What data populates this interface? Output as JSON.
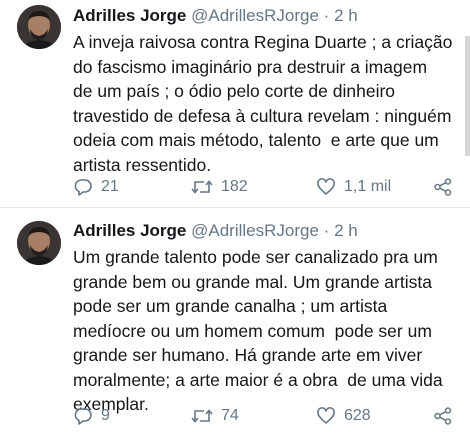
{
  "tweets": [
    {
      "author": "Adrilles Jorge",
      "handle": "@AdrillesRJorge",
      "separator": "·",
      "time": "2 h",
      "text": "A inveja raivosa contra Regina Duarte ; a criação\ndo fascismo imaginário pra destruir a imagem\nde um país ; o ódio pelo corte de dinheiro\ntravestido de defesa à cultura revelam : ninguém\nodeia com mais método, talento  e arte que um\nartista ressentido.",
      "replies": "21",
      "retweets": "182",
      "likes": "1,1 mil"
    },
    {
      "author": "Adrilles Jorge",
      "handle": "@AdrillesRJorge",
      "separator": "·",
      "time": "2 h",
      "text": "Um grande talento pode ser canalizado pra um\ngrande bem ou grande mal. Um grande artista\npode ser um grande canalha ; um artista\nmedíocre ou um homem comum  pode ser um\ngrande ser humano. Há grande arte em viver\nmoralmente; a arte maior é a obra  de uma vida\nexemplar.",
      "replies": "9",
      "retweets": "74",
      "likes": "628"
    }
  ],
  "icons": {
    "reply": "reply-icon",
    "retweet": "retweet-icon",
    "like": "heart-icon",
    "share": "share-icon"
  },
  "colors": {
    "text": "#14171a",
    "muted": "#657786",
    "divider": "#e1e8ed"
  }
}
